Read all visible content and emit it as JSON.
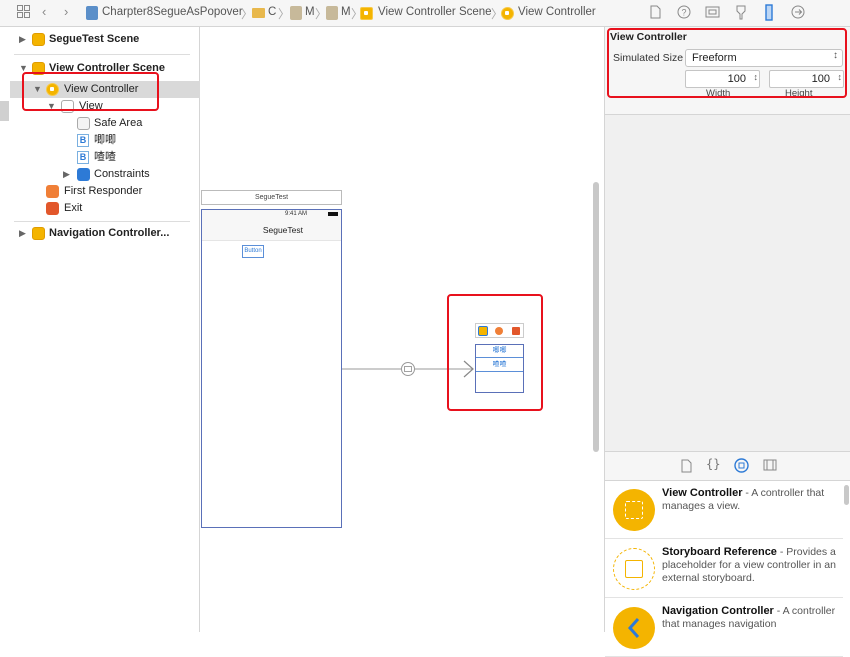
{
  "breadcrumb": {
    "project": "Charpter8SegueAsPopover",
    "folder": "C",
    "file1": "M",
    "file2": "M",
    "scene": "View Controller Scene",
    "controller": "View Controller"
  },
  "outline": {
    "items": [
      {
        "label": "SegueTest Scene"
      },
      {
        "label": "View Controller Scene"
      },
      {
        "label": "View Controller"
      },
      {
        "label": "View"
      },
      {
        "label": "Safe Area"
      },
      {
        "label": "唧唧"
      },
      {
        "label": "喳喳"
      },
      {
        "label": "Constraints"
      },
      {
        "label": "First Responder"
      },
      {
        "label": "Exit"
      },
      {
        "label": "Navigation Controller..."
      }
    ]
  },
  "canvas": {
    "scene_title": "SegueTest",
    "status_time": "9:41 AM",
    "nav_title": "SegueTest",
    "button_label": "Button",
    "popover_rows": [
      "唧唧",
      "喳喳"
    ]
  },
  "inspector": {
    "section_title": "View Controller",
    "simulated_size_label": "Simulated Size",
    "simulated_size_value": "Freeform",
    "width_value": "100",
    "height_value": "100",
    "width_label": "Width",
    "height_label": "Height"
  },
  "library": {
    "items": [
      {
        "name": "View Controller",
        "desc": " - A controller that manages a view."
      },
      {
        "name": "Storyboard Reference",
        "desc": " - Provides a placeholder for a view controller in an external storyboard."
      },
      {
        "name": "Navigation Controller",
        "desc": " - A controller that manages navigation"
      }
    ]
  },
  "colors": {
    "highlight": "#e8111d",
    "scene_icon": "#f4b400",
    "accent_blue": "#2d7ad6"
  }
}
